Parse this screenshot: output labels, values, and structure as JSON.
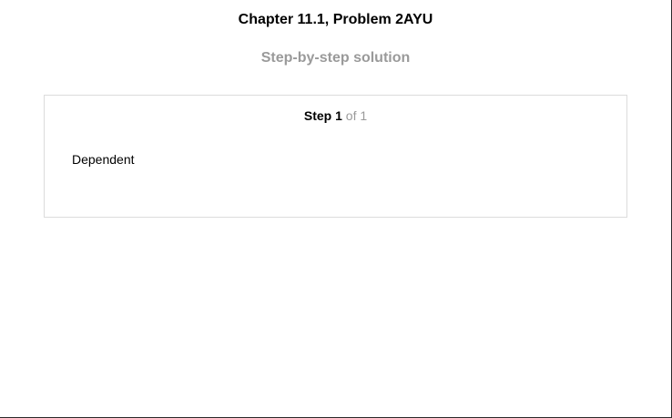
{
  "header": {
    "title": "Chapter 11.1, Problem 2AYU",
    "subtitle": "Step-by-step solution"
  },
  "step": {
    "word": "Step",
    "current": "1",
    "of_text": "of 1",
    "content": "Dependent"
  },
  "colors": {
    "muted_text": "#9a9a9a",
    "card_border": "#dcdcdc"
  }
}
